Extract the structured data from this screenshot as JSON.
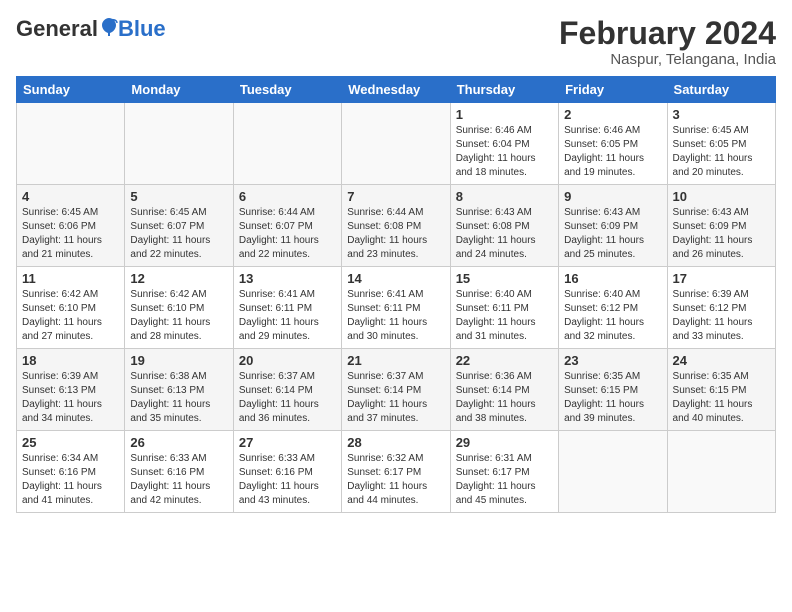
{
  "header": {
    "logo_general": "General",
    "logo_blue": "Blue",
    "main_title": "February 2024",
    "subtitle": "Naspur, Telangana, India"
  },
  "days_of_week": [
    "Sunday",
    "Monday",
    "Tuesday",
    "Wednesday",
    "Thursday",
    "Friday",
    "Saturday"
  ],
  "weeks": [
    [
      {
        "num": "",
        "info": ""
      },
      {
        "num": "",
        "info": ""
      },
      {
        "num": "",
        "info": ""
      },
      {
        "num": "",
        "info": ""
      },
      {
        "num": "1",
        "info": "Sunrise: 6:46 AM\nSunset: 6:04 PM\nDaylight: 11 hours and 18 minutes."
      },
      {
        "num": "2",
        "info": "Sunrise: 6:46 AM\nSunset: 6:05 PM\nDaylight: 11 hours and 19 minutes."
      },
      {
        "num": "3",
        "info": "Sunrise: 6:45 AM\nSunset: 6:05 PM\nDaylight: 11 hours and 20 minutes."
      }
    ],
    [
      {
        "num": "4",
        "info": "Sunrise: 6:45 AM\nSunset: 6:06 PM\nDaylight: 11 hours and 21 minutes."
      },
      {
        "num": "5",
        "info": "Sunrise: 6:45 AM\nSunset: 6:07 PM\nDaylight: 11 hours and 22 minutes."
      },
      {
        "num": "6",
        "info": "Sunrise: 6:44 AM\nSunset: 6:07 PM\nDaylight: 11 hours and 22 minutes."
      },
      {
        "num": "7",
        "info": "Sunrise: 6:44 AM\nSunset: 6:08 PM\nDaylight: 11 hours and 23 minutes."
      },
      {
        "num": "8",
        "info": "Sunrise: 6:43 AM\nSunset: 6:08 PM\nDaylight: 11 hours and 24 minutes."
      },
      {
        "num": "9",
        "info": "Sunrise: 6:43 AM\nSunset: 6:09 PM\nDaylight: 11 hours and 25 minutes."
      },
      {
        "num": "10",
        "info": "Sunrise: 6:43 AM\nSunset: 6:09 PM\nDaylight: 11 hours and 26 minutes."
      }
    ],
    [
      {
        "num": "11",
        "info": "Sunrise: 6:42 AM\nSunset: 6:10 PM\nDaylight: 11 hours and 27 minutes."
      },
      {
        "num": "12",
        "info": "Sunrise: 6:42 AM\nSunset: 6:10 PM\nDaylight: 11 hours and 28 minutes."
      },
      {
        "num": "13",
        "info": "Sunrise: 6:41 AM\nSunset: 6:11 PM\nDaylight: 11 hours and 29 minutes."
      },
      {
        "num": "14",
        "info": "Sunrise: 6:41 AM\nSunset: 6:11 PM\nDaylight: 11 hours and 30 minutes."
      },
      {
        "num": "15",
        "info": "Sunrise: 6:40 AM\nSunset: 6:11 PM\nDaylight: 11 hours and 31 minutes."
      },
      {
        "num": "16",
        "info": "Sunrise: 6:40 AM\nSunset: 6:12 PM\nDaylight: 11 hours and 32 minutes."
      },
      {
        "num": "17",
        "info": "Sunrise: 6:39 AM\nSunset: 6:12 PM\nDaylight: 11 hours and 33 minutes."
      }
    ],
    [
      {
        "num": "18",
        "info": "Sunrise: 6:39 AM\nSunset: 6:13 PM\nDaylight: 11 hours and 34 minutes."
      },
      {
        "num": "19",
        "info": "Sunrise: 6:38 AM\nSunset: 6:13 PM\nDaylight: 11 hours and 35 minutes."
      },
      {
        "num": "20",
        "info": "Sunrise: 6:37 AM\nSunset: 6:14 PM\nDaylight: 11 hours and 36 minutes."
      },
      {
        "num": "21",
        "info": "Sunrise: 6:37 AM\nSunset: 6:14 PM\nDaylight: 11 hours and 37 minutes."
      },
      {
        "num": "22",
        "info": "Sunrise: 6:36 AM\nSunset: 6:14 PM\nDaylight: 11 hours and 38 minutes."
      },
      {
        "num": "23",
        "info": "Sunrise: 6:35 AM\nSunset: 6:15 PM\nDaylight: 11 hours and 39 minutes."
      },
      {
        "num": "24",
        "info": "Sunrise: 6:35 AM\nSunset: 6:15 PM\nDaylight: 11 hours and 40 minutes."
      }
    ],
    [
      {
        "num": "25",
        "info": "Sunrise: 6:34 AM\nSunset: 6:16 PM\nDaylight: 11 hours and 41 minutes."
      },
      {
        "num": "26",
        "info": "Sunrise: 6:33 AM\nSunset: 6:16 PM\nDaylight: 11 hours and 42 minutes."
      },
      {
        "num": "27",
        "info": "Sunrise: 6:33 AM\nSunset: 6:16 PM\nDaylight: 11 hours and 43 minutes."
      },
      {
        "num": "28",
        "info": "Sunrise: 6:32 AM\nSunset: 6:17 PM\nDaylight: 11 hours and 44 minutes."
      },
      {
        "num": "29",
        "info": "Sunrise: 6:31 AM\nSunset: 6:17 PM\nDaylight: 11 hours and 45 minutes."
      },
      {
        "num": "",
        "info": ""
      },
      {
        "num": "",
        "info": ""
      }
    ]
  ]
}
